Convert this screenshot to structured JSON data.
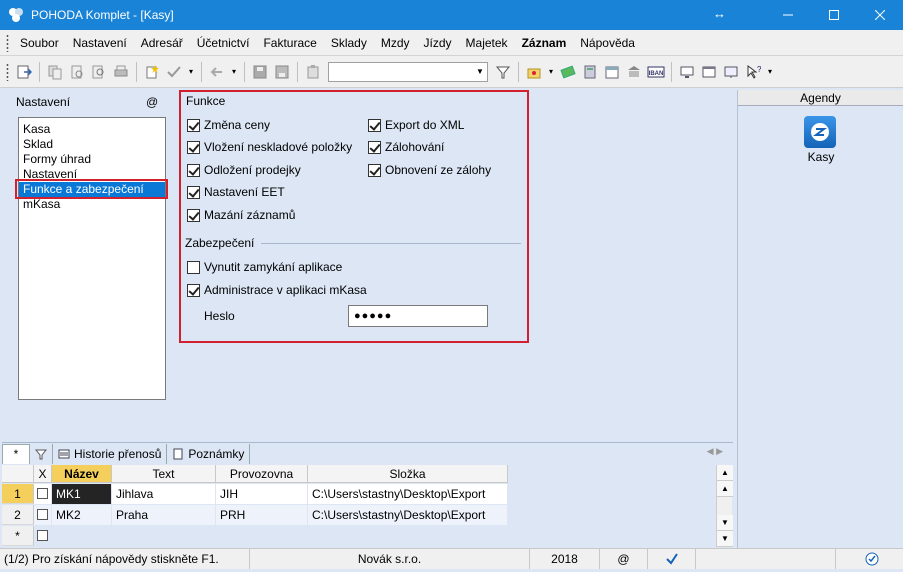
{
  "window": {
    "title": "POHODA Komplet - [Kasy]"
  },
  "menu": [
    "Soubor",
    "Nastavení",
    "Adresář",
    "Účetnictví",
    "Fakturace",
    "Sklady",
    "Mzdy",
    "Jízdy",
    "Majetek",
    "Záznam",
    "Nápověda"
  ],
  "left_panel": {
    "label": "Nastavení",
    "at_symbol": "@",
    "items": [
      "Kasa",
      "Sklad",
      "Formy úhrad",
      "Nastavení",
      "Funkce a zabezpečení",
      "mKasa"
    ],
    "selected": "Funkce a zabezpečení"
  },
  "funkce": {
    "title": "Funkce",
    "left_items": [
      {
        "label": "Změna ceny",
        "checked": true
      },
      {
        "label": "Vložení neskladové položky",
        "checked": true
      },
      {
        "label": "Odložení prodejky",
        "checked": true
      },
      {
        "label": "Nastavení EET",
        "checked": true
      },
      {
        "label": "Mazání záznamů",
        "checked": true
      }
    ],
    "right_items": [
      {
        "label": "Export do XML",
        "checked": true
      },
      {
        "label": "Zálohování",
        "checked": true
      },
      {
        "label": "Obnovení ze zálohy",
        "checked": true
      }
    ]
  },
  "zabezpeceni": {
    "title": "Zabezpečení",
    "items": [
      {
        "label": "Vynutit zamykání aplikace",
        "checked": false
      },
      {
        "label": "Administrace v aplikaci mKasa",
        "checked": true
      }
    ],
    "password_label": "Heslo",
    "password_mask": "●●●●●"
  },
  "agendy": {
    "header": "Agendy",
    "item": "Kasy"
  },
  "tabs": {
    "star": "*",
    "historie": "Historie přenosů",
    "poznamky": "Poznámky"
  },
  "grid": {
    "headers": {
      "x": "X",
      "nazev": "Název",
      "text": "Text",
      "provozovna": "Provozovna",
      "slozka": "Složka"
    },
    "rows": [
      {
        "num": "1",
        "nazev": "MK1",
        "text": "Jihlava",
        "provozovna": "JIH",
        "slozka": "C:\\Users\\stastny\\Desktop\\Export"
      },
      {
        "num": "2",
        "nazev": "MK2",
        "text": "Praha",
        "provozovna": "PRH",
        "slozka": "C:\\Users\\stastny\\Desktop\\Export"
      }
    ],
    "new_row_marker": "*"
  },
  "status": {
    "hint": "(1/2) Pro získání nápovědy stiskněte F1.",
    "company": "Novák s.r.o.",
    "year": "2018",
    "at": "@"
  },
  "colors": {
    "titlebar": "#1883d7",
    "selection": "#0a78d7",
    "highlight_outline": "#d3202f",
    "panel_bg": "#dce6f4"
  }
}
